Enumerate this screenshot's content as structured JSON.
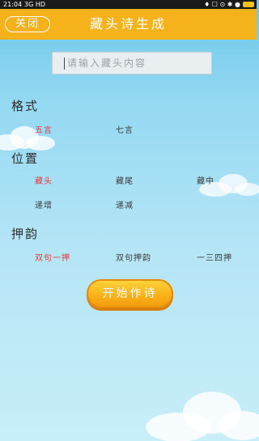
{
  "status_bar": {
    "time": "21:04",
    "signal": "3G HD",
    "icons": "♦ ☐ ⊙ ✱ ●"
  },
  "header": {
    "close_label": "关闭",
    "title": "藏头诗生成"
  },
  "input": {
    "placeholder": "请输入藏头内容"
  },
  "format": {
    "label": "格式",
    "options": [
      "五言",
      "七言"
    ],
    "selected": "五言"
  },
  "position": {
    "label": "位置",
    "options": [
      "藏头",
      "藏尾",
      "藏中",
      "递增",
      "递减"
    ],
    "selected": "藏头"
  },
  "rhyme": {
    "label": "押韵",
    "options": [
      "双句一押",
      "双句押韵",
      "一三四押"
    ],
    "selected": "双句一押"
  },
  "start_button": {
    "label": "开始作诗"
  },
  "colors": {
    "header": "#f6b21a",
    "selected_option": "#e23b3b",
    "background_top": "#6ac6ea",
    "background_bottom": "#c8eef9"
  }
}
